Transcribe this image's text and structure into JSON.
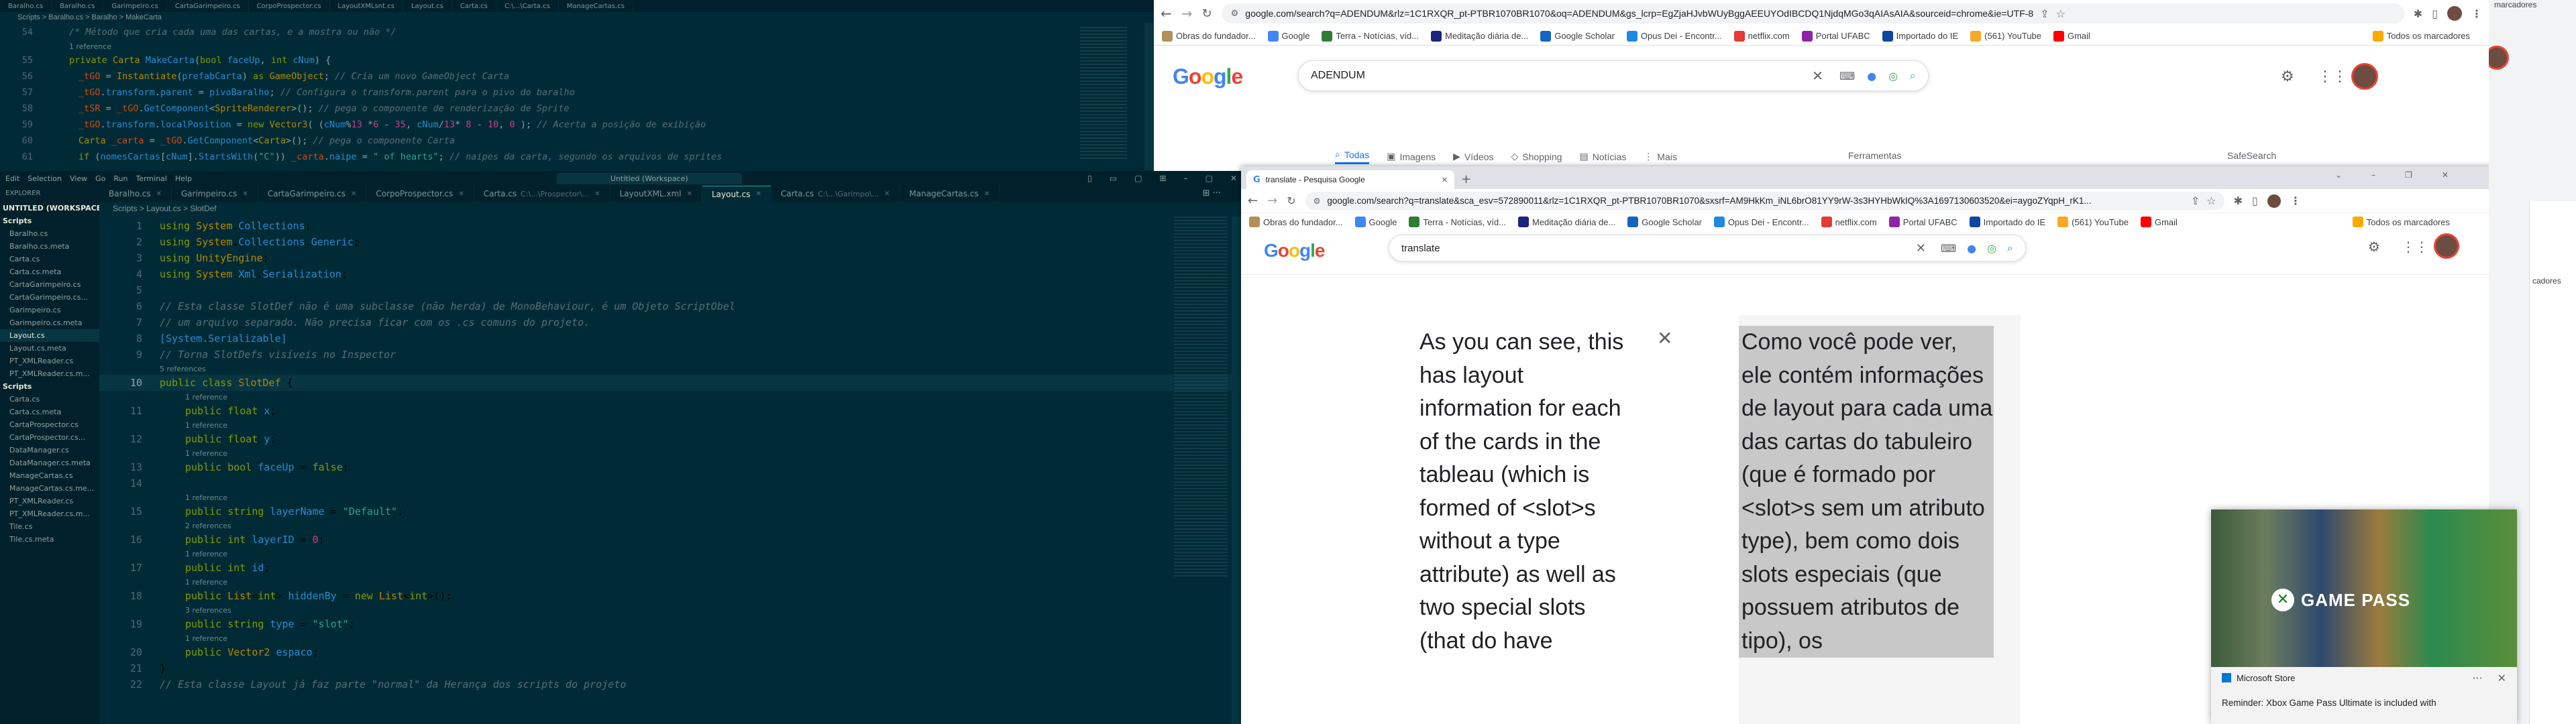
{
  "vs_top": {
    "tabs": [
      "Baralho.cs",
      "Baralho.cs",
      "Garimpeiro.cs",
      "CartaGarimpeiro.cs",
      "CorpoProspector.cs",
      "LayoutXMLsnt.cs",
      "Layout.cs",
      "Carta.cs",
      "C:\\...\\Carta.cs",
      "ManageCartas.cs"
    ],
    "breadcrumb": "Scripts > Baralho.cs > Baralho > MakeCarta",
    "lines": [
      {
        "n": "54",
        "text": "/* Método que cria cada uma das cartas, e a mostra ou não */",
        "kind": "cm",
        "indent": 2
      },
      {
        "n": "",
        "text": "1 reference",
        "kind": "ref",
        "indent": 2
      },
      {
        "n": "55",
        "text": "private Carta MakeCarta(bool faceUp, int cNum) {",
        "kind": "code",
        "indent": 2
      },
      {
        "n": "56",
        "text": "_tGO = Instantiate(prefabCarta) as GameObject; // Cria um novo GameObject Carta",
        "kind": "code",
        "indent": 3
      },
      {
        "n": "57",
        "text": "_tGO.transform.parent = pivoBaralho; // Configura o transform.parent para o pivo do baralho",
        "kind": "code",
        "indent": 3
      },
      {
        "n": "58",
        "text": "_tSR = _tGO.GetComponent<SpriteRenderer>(); // pega o componente de renderização de Sprite",
        "kind": "code",
        "indent": 3
      },
      {
        "n": "59",
        "text": "_tGO.transform.localPosition = new Vector3( (cNum%13 *6 - 35, cNum/13* 8 - 10, 0 ); // Acerta a posição de exibição",
        "kind": "code",
        "indent": 3
      },
      {
        "n": "60",
        "text": "Carta _carta = _tGO.GetComponent<Carta>(); // pega o componente Carta",
        "kind": "code",
        "indent": 3
      },
      {
        "n": "61",
        "text": "if (nomesCartas[cNum].StartsWith(\"C\")) _carta.naipe = \" of hearts\"; // naipes da carta, segundo os arquivos de sprites",
        "kind": "code",
        "indent": 3
      }
    ]
  },
  "vs_main": {
    "menu": [
      "Edit",
      "Selection",
      "View",
      "Go",
      "Run",
      "Terminal",
      "Help"
    ],
    "title": "Untitled (Workspace)",
    "tabs": [
      {
        "label": "Baralho.cs",
        "active": false
      },
      {
        "label": "Garimpeiro.cs",
        "active": false
      },
      {
        "label": "CartaGarimpeiro.cs",
        "active": false
      },
      {
        "label": "CorpoProspector.cs",
        "active": false
      },
      {
        "label": "Carta.cs",
        "dim": "C:\\...\\Prospector\\...",
        "active": false
      },
      {
        "label": "LayoutXML.xml",
        "active": false
      },
      {
        "label": "Layout.cs",
        "active": true
      },
      {
        "label": "Carta.cs",
        "dim": "C:\\...\\Garimpo\\...",
        "active": false
      },
      {
        "label": "ManageCartas.cs",
        "active": false
      }
    ],
    "breadcrumb": "Scripts > Layout.cs > SlotDef",
    "explorer_title": "EXPLORER",
    "explorer": [
      {
        "t": "UNTITLED (WORKSPACE)",
        "sec": true
      },
      {
        "t": "Scripts",
        "sec": true
      },
      {
        "t": "Baralho.cs"
      },
      {
        "t": "Baralho.cs.meta"
      },
      {
        "t": "Carta.cs"
      },
      {
        "t": "Carta.cs.meta"
      },
      {
        "t": "CartaGarimpeiro.cs"
      },
      {
        "t": "CartaGarimpeiro.cs..."
      },
      {
        "t": "Garimpeiro.cs"
      },
      {
        "t": "Garimpeiro.cs.meta"
      },
      {
        "t": "Layout.cs",
        "sel": true
      },
      {
        "t": "Layout.cs.meta"
      },
      {
        "t": "PT_XMLReader.cs"
      },
      {
        "t": "PT_XMLReader.cs.m..."
      },
      {
        "t": "Scripts",
        "sec": true
      },
      {
        "t": "Carta.cs"
      },
      {
        "t": "Carta.cs.meta"
      },
      {
        "t": "CartaProspector.cs"
      },
      {
        "t": "CartaProspector.cs..."
      },
      {
        "t": "DataManager.cs"
      },
      {
        "t": "DataManager.cs.meta"
      },
      {
        "t": "ManageCartas.cs"
      },
      {
        "t": "ManageCartas.cs.me..."
      },
      {
        "t": "PT_XMLReader.cs"
      },
      {
        "t": "PT_XMLReader.cs.m..."
      },
      {
        "t": "Tile.cs"
      },
      {
        "t": "Tile.cs.meta"
      }
    ],
    "lines": [
      {
        "n": "1",
        "text": "using System.Collections;",
        "kind": "using",
        "indent": 0
      },
      {
        "n": "2",
        "text": "using System.Collections.Generic;",
        "kind": "using",
        "indent": 0
      },
      {
        "n": "3",
        "text": "using UnityEngine;",
        "kind": "using",
        "indent": 0
      },
      {
        "n": "4",
        "text": "using System.Xml.Serialization;",
        "kind": "using",
        "indent": 0
      },
      {
        "n": "5",
        "text": "",
        "kind": "blank",
        "indent": 0
      },
      {
        "n": "6",
        "text": "// Esta classe SlotDef não é uma subclasse (não herda) de MonoBehaviour, é um Objeto ScriptObel",
        "kind": "cm",
        "indent": 0
      },
      {
        "n": "7",
        "text": "// um arquivo separado. Não precisa ficar com os .cs comuns do projeto.",
        "kind": "cm",
        "indent": 0
      },
      {
        "n": "8",
        "text": "[System.Serializable]",
        "kind": "attr",
        "indent": 0
      },
      {
        "n": "9",
        "text": "// Torna SlotDefs visíveis no Inspector",
        "kind": "cm",
        "indent": 0
      },
      {
        "n": "",
        "text": "5 references",
        "kind": "ref",
        "indent": 0
      },
      {
        "n": "10",
        "text": "public class SlotDef {",
        "kind": "class",
        "indent": 0,
        "cur": true
      },
      {
        "n": "",
        "text": "1 reference",
        "kind": "ref",
        "indent": 1
      },
      {
        "n": "11",
        "text": "public float x;",
        "kind": "field",
        "indent": 1
      },
      {
        "n": "",
        "text": "1 reference",
        "kind": "ref",
        "indent": 1
      },
      {
        "n": "12",
        "text": "public float y;",
        "kind": "field",
        "indent": 1
      },
      {
        "n": "",
        "text": "1 reference",
        "kind": "ref",
        "indent": 1
      },
      {
        "n": "13",
        "text": "public bool faceUp = false;",
        "kind": "field",
        "indent": 1
      },
      {
        "n": "14",
        "text": "",
        "kind": "blank",
        "indent": 0
      },
      {
        "n": "",
        "text": "1 reference",
        "kind": "ref",
        "indent": 1
      },
      {
        "n": "15",
        "text": "public string layerName = \"Default\";",
        "kind": "field",
        "indent": 1
      },
      {
        "n": "",
        "text": "2 references",
        "kind": "ref",
        "indent": 1
      },
      {
        "n": "16",
        "text": "public int layerID = 0;",
        "kind": "field",
        "indent": 1
      },
      {
        "n": "",
        "text": "1 reference",
        "kind": "ref",
        "indent": 1
      },
      {
        "n": "17",
        "text": "public int id;",
        "kind": "field",
        "indent": 1
      },
      {
        "n": "",
        "text": "1 reference",
        "kind": "ref",
        "indent": 1
      },
      {
        "n": "18",
        "text": "public List<int> hiddenBy = new List<int>();",
        "kind": "field",
        "indent": 1
      },
      {
        "n": "",
        "text": "3 references",
        "kind": "ref",
        "indent": 1
      },
      {
        "n": "19",
        "text": "public string type = \"slot\";",
        "kind": "field",
        "indent": 1
      },
      {
        "n": "",
        "text": "1 reference",
        "kind": "ref",
        "indent": 1
      },
      {
        "n": "20",
        "text": "public Vector2 espaco;",
        "kind": "field",
        "indent": 1
      },
      {
        "n": "21",
        "text": "}",
        "kind": "code",
        "indent": 0
      },
      {
        "n": "22",
        "text": "// Esta classe Layout já faz parte \"normal\" da Herança dos scripts do projeto",
        "kind": "cm",
        "indent": 0
      }
    ]
  },
  "chrome_top": {
    "url": "google.com/search?q=ADENDUM&rlz=1C1RXQR_pt-PTBR1070BR1070&oq=ADENDUM&gs_lcrp=EgZjaHJvbWUyBggAEEUYOdIBCDQ1NjdqMGo3qAIAsAIA&sourceid=chrome&ie=UTF-8",
    "bookmarks": [
      "Obras do fundador...",
      "Google",
      "Terra - Notícias, víd...",
      "Meditação diária de...",
      "Google Scholar",
      "Opus Dei - Encontr...",
      "netflix.com",
      "Portal UFABC",
      "Importado do IE",
      "(561) YouTube",
      "Gmail"
    ],
    "all_bookmarks": "Todos os marcadores",
    "search_value": "ADENDUM",
    "nav": [
      "Todas",
      "Imagens",
      "Vídeos",
      "Shopping",
      "Notícias",
      "Mais"
    ],
    "tools": "Ferramentas",
    "safesearch": "SafeSearch"
  },
  "chrome_mid": {
    "tab_title": "translate - Pesquisa Google",
    "url": "google.com/search?q=translate&sca_esv=572890011&rlz=1C1RXQR_pt-PTBR1070BR1070&sxsrf=AM9HkKm_iNL6brO81YY9rW-3s3HYHbWkIQ%3A1697130603520&ei=aygoZYqpH_rK1...",
    "bookmarks": [
      "Obras do fundador...",
      "Google",
      "Terra - Notícias, víd...",
      "Meditação diária de...",
      "Google Scholar",
      "Opus Dei - Encontr...",
      "netflix.com",
      "Portal UFABC",
      "Importado do IE",
      "(561) YouTube",
      "Gmail"
    ],
    "all_bookmarks": "Todos os marcadores",
    "search_value": "translate",
    "source_text": "As you can see, this has layout information for each of the cards in the tableau (which is formed of <slot>s without a type attribute) as well as two special slots (that do have",
    "translated_text": "Como você pode ver, ele contém informações de layout para cada uma das cartas do tabuleiro (que é formado por <slot>s sem um atributo type), bem como dois slots especiais (que possuem atributos de tipo), os"
  },
  "right_edge": {
    "text1": "marcadores",
    "text2": "cadores"
  },
  "notification": {
    "banner": "GAME PASS",
    "app": "Microsoft Store",
    "text": "Reminder: Xbox Game Pass Ultimate is included with"
  },
  "colors": {
    "vs_bg": "#002b36",
    "accent": "#1a73e8",
    "translate_highlight": "#c8c8c8"
  }
}
